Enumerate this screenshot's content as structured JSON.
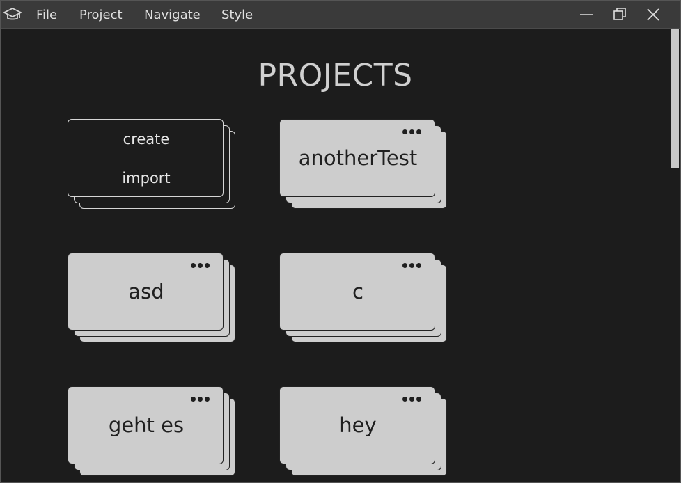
{
  "menu": {
    "items": [
      "File",
      "Project",
      "Navigate",
      "Style"
    ]
  },
  "window_controls": {
    "minimize": "minimize-icon",
    "restore": "restore-icon",
    "close": "close-icon"
  },
  "page": {
    "title": "PROJECTS"
  },
  "actions": {
    "create_label": "create",
    "import_label": "import"
  },
  "projects": [
    {
      "name": "anotherTest"
    },
    {
      "name": "asd"
    },
    {
      "name": "c"
    },
    {
      "name": "geht es"
    },
    {
      "name": "hey"
    }
  ],
  "colors": {
    "background": "#1c1c1c",
    "titlebar": "#3a3a3a",
    "card": "#cdcdcd",
    "text_light": "#d0d0d0"
  }
}
